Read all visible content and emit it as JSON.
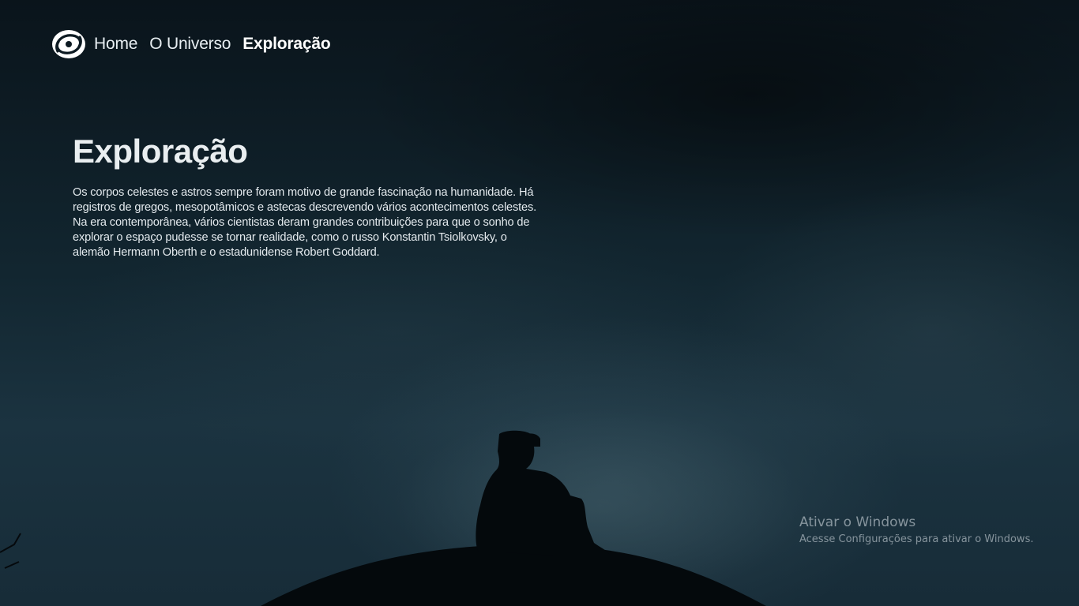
{
  "nav": {
    "logo_icon": "swirl-logo-icon",
    "links": [
      {
        "label": "Home"
      },
      {
        "label": "O Universo"
      },
      {
        "label": "Exploração"
      }
    ],
    "active_index": 2
  },
  "main": {
    "title": "Exploração",
    "text": "Os corpos celestes e astros sempre foram motivo de grande fascinação na humanidade. Há registros de gregos, mesopotâmicos e astecas descrevendo vários acontecimentos celestes. Na era contemporânea, vários cientistas deram grandes contribuições para que o sonho de explorar o espaço pudesse se tornar realidade, como o russo Konstantin Tsiolkovsky, o alemão Hermann Oberth e o estadunidense Robert Goddard."
  },
  "windows_watermark": {
    "title": "Ativar o Windows",
    "subtitle": "Acesse Configurações para ativar o Windows."
  },
  "colors": {
    "background": "#0d1a22",
    "text": "#e9eef0"
  }
}
